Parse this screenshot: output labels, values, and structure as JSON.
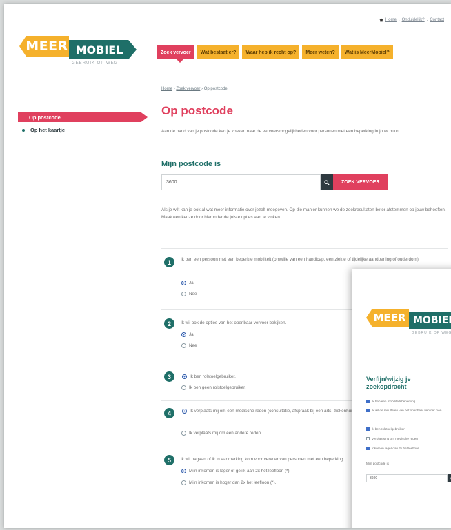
{
  "toplinks": {
    "home": "Home",
    "sep1": ",",
    "feedback": "Onduidelijk?",
    "sep2": ",",
    "contact": "Contact"
  },
  "logo": {
    "meer": "MEER",
    "mobiel": "MOBIEL",
    "tagline": "GEBRUIK OP WEG"
  },
  "nav": {
    "items": [
      "Zoek vervoer",
      "Wat bestaat er?",
      "Waar heb ik recht op?",
      "Meer weten?",
      "Wat is MeerMobiel?"
    ]
  },
  "sidebar": {
    "items": [
      "Op postcode",
      "Op het kaartje"
    ]
  },
  "breadcrumb": {
    "home": "Home",
    "parent": "Zoek vervoer",
    "current": "Op postcode",
    "sep": "›"
  },
  "main": {
    "title": "Op postcode",
    "intro": "Aan de hand van je postcode kan je zoeken naar de vervoersmogelijkheden voor personen met een beperking in jouw buurt.",
    "postcode_title": "Mijn postcode is",
    "postcode_value": "3600",
    "search_label": "ZOEK VERVOER",
    "more_info": "Als je wilt kan je ook al wat meer informatie over jezelf meegeven. Op die manier kunnen we de zoekresultaten beter afstemmen op jouw behoeften. Maak een keuze door hieronder de juiste opties aan te vinken."
  },
  "questions": [
    {
      "num": "1",
      "text": "Ik ben een persoon met een beperkte mobiliteit (omwille van een handicap, een ziekte of tijdelijke aandoening of ouderdom).",
      "options": [
        {
          "label": "Ja",
          "checked": true
        },
        {
          "label": "Nee",
          "checked": false
        }
      ]
    },
    {
      "num": "2",
      "text": "Ik wil ook de opties van het openbaar vervoer bekijken.",
      "options": [
        {
          "label": "Ja",
          "checked": true
        },
        {
          "label": "Nee",
          "checked": false
        }
      ]
    },
    {
      "num": "3",
      "text": "",
      "options": [
        {
          "label": "Ik ben rolstoelgebruiker.",
          "checked": true
        },
        {
          "label": "Ik ben geen rolstoelgebruiker.",
          "checked": false
        }
      ]
    },
    {
      "num": "4",
      "text": "",
      "options": [
        {
          "label": "Ik verplaats mij om een medische reden (consultatie, afspraak bij een arts, ziekenhuis, medische behandeling ...).",
          "checked": true
        },
        {
          "label": "Ik verplaats mij om een andere reden.",
          "checked": false
        }
      ]
    },
    {
      "num": "5",
      "text": "Ik wil nagaan of ik in aanmerking kom voor vervoer van personen met een beperking.",
      "options": [
        {
          "label": "Mijn inkomen is lager of gelijk aan 2x het leefloon (*).",
          "checked": true
        },
        {
          "label": "Mijn inkomen is hoger dan 2x het leefloon (*).",
          "checked": false
        }
      ]
    }
  ],
  "overlay": {
    "title": "Verfijn/wijzig je zoekopdracht",
    "items": [
      {
        "label": "Ik heb een mobiliteitsbeperking",
        "checked": true
      },
      {
        "label": "Ik wil de resultaten van het openbaar vervoer zien",
        "checked": true
      },
      {
        "label": "Ik ben rolstoelgebruiker",
        "checked": true
      },
      {
        "label": "Verplaatsing om medische reden",
        "checked": false
      },
      {
        "label": "Inkomen lager dan 2x het leefloon",
        "checked": true
      }
    ],
    "postcode_label": "Mijn postcode is",
    "postcode_value": "3600"
  },
  "colors": {
    "accent": "#e0405e",
    "teal": "#1f6f68",
    "yellow": "#f5b12c"
  }
}
